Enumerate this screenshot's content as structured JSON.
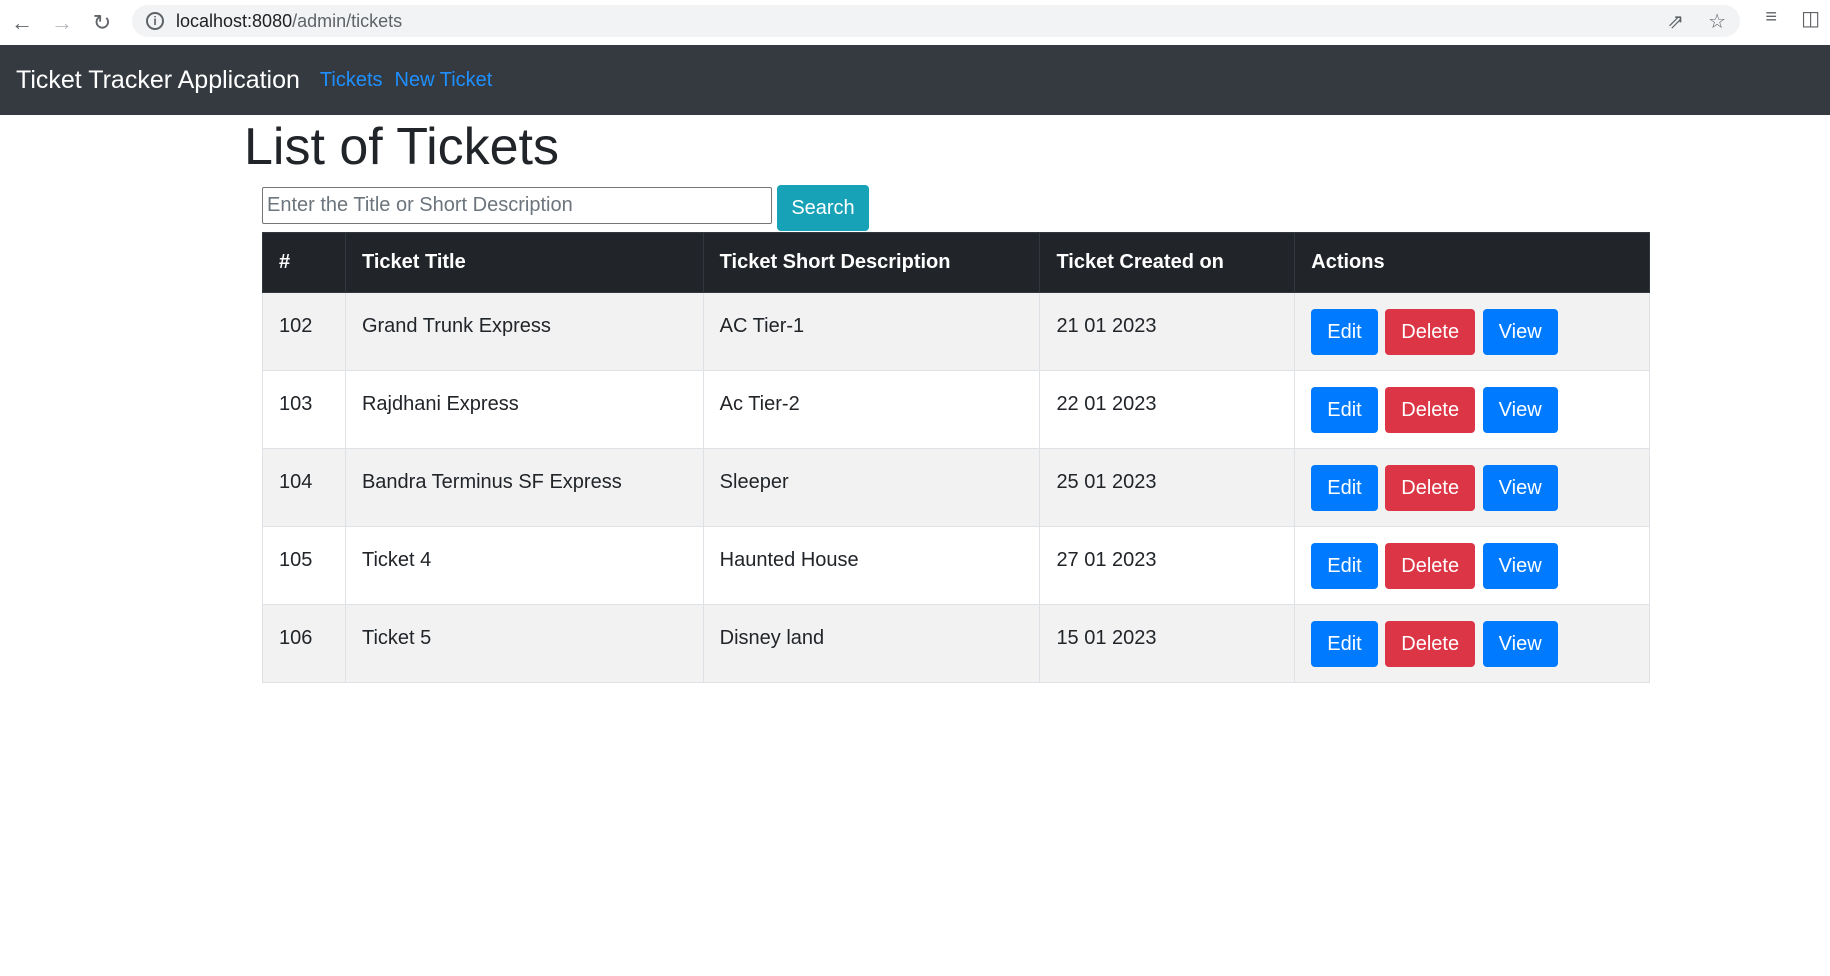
{
  "browser": {
    "url_host": "localhost:8080",
    "url_path": "/admin/tickets"
  },
  "navbar": {
    "brand": "Ticket Tracker Application",
    "links": [
      "Tickets",
      "New Ticket"
    ]
  },
  "page": {
    "title": "List of Tickets",
    "search_placeholder": "Enter the Title or Short Description",
    "search_button": "Search"
  },
  "table": {
    "headers": [
      "#",
      "Ticket Title",
      "Ticket Short Description",
      "Ticket Created on",
      "Actions"
    ],
    "rows": [
      {
        "id": "102",
        "title": "Grand Trunk Express",
        "description": "AC Tier-1",
        "created": "21 01 2023"
      },
      {
        "id": "103",
        "title": "Rajdhani Express",
        "description": "Ac Tier-2",
        "created": "22 01 2023"
      },
      {
        "id": "104",
        "title": "Bandra Terminus SF Express",
        "description": "Sleeper",
        "created": "25 01 2023"
      },
      {
        "id": "105",
        "title": "Ticket 4",
        "description": "Haunted House",
        "created": "27 01 2023"
      },
      {
        "id": "106",
        "title": "Ticket 5",
        "description": "Disney land",
        "created": "15 01 2023"
      }
    ],
    "action_labels": {
      "edit": "Edit",
      "delete": "Delete",
      "view": "View"
    }
  },
  "colors": {
    "navbar_bg": "#343a40",
    "link": "#1e90ff",
    "search_btn": "#17a2b8",
    "edit_view": "#007bff",
    "delete": "#dc3545",
    "table_header": "#212529"
  },
  "icons": [
    "back-icon",
    "forward-icon",
    "reload-icon",
    "site-info-icon",
    "share-icon",
    "bookmark-star-icon",
    "reading-list-icon",
    "side-panel-icon"
  ]
}
